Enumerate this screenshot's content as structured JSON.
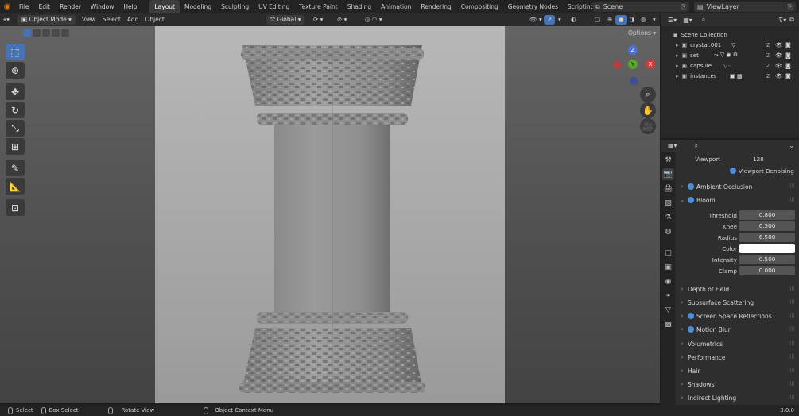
{
  "topbar": {
    "menus": [
      "File",
      "Edit",
      "Render",
      "Window",
      "Help"
    ],
    "workspaces": [
      "Layout",
      "Modeling",
      "Sculpting",
      "UV Editing",
      "Texture Paint",
      "Shading",
      "Animation",
      "Rendering",
      "Compositing",
      "Geometry Nodes",
      "Scripting"
    ],
    "active_workspace": "Layout",
    "add_tab": "+",
    "scene": "Scene",
    "view_layer": "ViewLayer"
  },
  "viewport_header": {
    "mode": "Object Mode",
    "menus": [
      "View",
      "Select",
      "Add",
      "Object"
    ],
    "orientation": "Global",
    "options": "Options"
  },
  "gizmo": {
    "z": "Z",
    "y": "Y",
    "x": "X"
  },
  "outliner": {
    "root": "Scene Collection",
    "items": [
      {
        "name": "crystal.001"
      },
      {
        "name": "set"
      },
      {
        "name": "capsule"
      },
      {
        "name": "instances"
      }
    ]
  },
  "properties": {
    "viewport_label": "Viewport",
    "viewport_value": "128",
    "viewport_denoising": "Viewport Denoising",
    "ambient_occlusion": "Ambient Occlusion",
    "bloom": {
      "title": "Bloom",
      "threshold_label": "Threshold",
      "threshold": "0.800",
      "knee_label": "Knee",
      "knee": "0.500",
      "radius_label": "Radius",
      "radius": "6.500",
      "color_label": "Color",
      "intensity_label": "Intensity",
      "intensity": "0.500",
      "clamp_label": "Clamp",
      "clamp": "0.000"
    },
    "panels": [
      "Depth of Field",
      "Subsurface Scattering",
      "Screen Space Reflections",
      "Motion Blur",
      "Volumetrics",
      "Performance",
      "Hair",
      "Shadows",
      "Indirect Lighting"
    ]
  },
  "statusbar": {
    "select": "Select",
    "box_select": "Box Select",
    "rotate_view": "Rotate View",
    "context_menu": "Object Context Menu",
    "version": "3.0.0"
  },
  "colors": {
    "accent": "#4772b3",
    "dot": "#4d8fd6",
    "bg": "#1d1d1d"
  }
}
